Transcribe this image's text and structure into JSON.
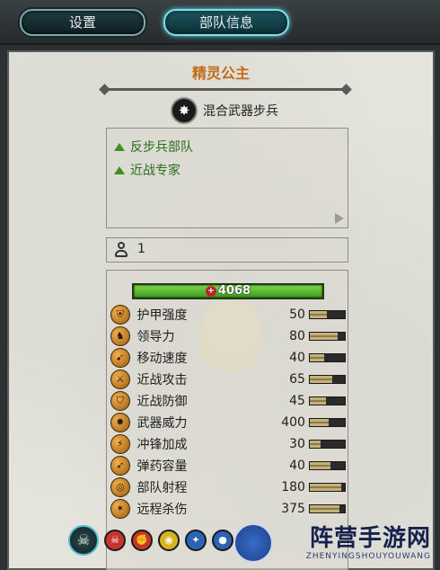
{
  "tabs": [
    {
      "label": "设置",
      "active": false
    },
    {
      "label": "部队信息",
      "active": true
    }
  ],
  "unit": {
    "name": "精灵公主",
    "type_label": "混合武器步兵",
    "traits": [
      {
        "label": "反步兵部队"
      },
      {
        "label": "近战专家"
      }
    ],
    "count": "1",
    "health": "4068"
  },
  "stats": [
    {
      "label": "护甲强度",
      "value": "50",
      "fill": 0.5,
      "icon": "armor-icon"
    },
    {
      "label": "领导力",
      "value": "80",
      "fill": 0.8,
      "icon": "leadership-icon"
    },
    {
      "label": "移动速度",
      "value": "40",
      "fill": 0.4,
      "icon": "speed-icon"
    },
    {
      "label": "近战攻击",
      "value": "65",
      "fill": 0.65,
      "icon": "melee-attack-icon"
    },
    {
      "label": "近战防御",
      "value": "45",
      "fill": 0.45,
      "icon": "melee-defense-icon"
    },
    {
      "label": "武器威力",
      "value": "400",
      "fill": 0.55,
      "icon": "weapon-strength-icon"
    },
    {
      "label": "冲锋加成",
      "value": "30",
      "fill": 0.3,
      "icon": "charge-bonus-icon"
    },
    {
      "label": "弹药容量",
      "value": "40",
      "fill": 0.6,
      "icon": "ammo-icon"
    },
    {
      "label": "部队射程",
      "value": "180",
      "fill": 0.9,
      "icon": "range-icon"
    },
    {
      "label": "远程杀伤",
      "value": "375",
      "fill": 0.85,
      "icon": "missile-damage-icon"
    }
  ],
  "abilities": [
    {
      "icon": "skull-icon",
      "color": "#c8352a"
    },
    {
      "icon": "fist-icon",
      "color": "#c8352a"
    },
    {
      "icon": "eye-icon",
      "color": "#d6b21c"
    },
    {
      "icon": "wings-icon",
      "color": "#2b63b6"
    },
    {
      "icon": "orb-icon",
      "color": "#2b63b6"
    }
  ],
  "watermark": {
    "title": "阵营手游网",
    "subtitle": "ZHENYINGSHOUYOUWANG"
  }
}
